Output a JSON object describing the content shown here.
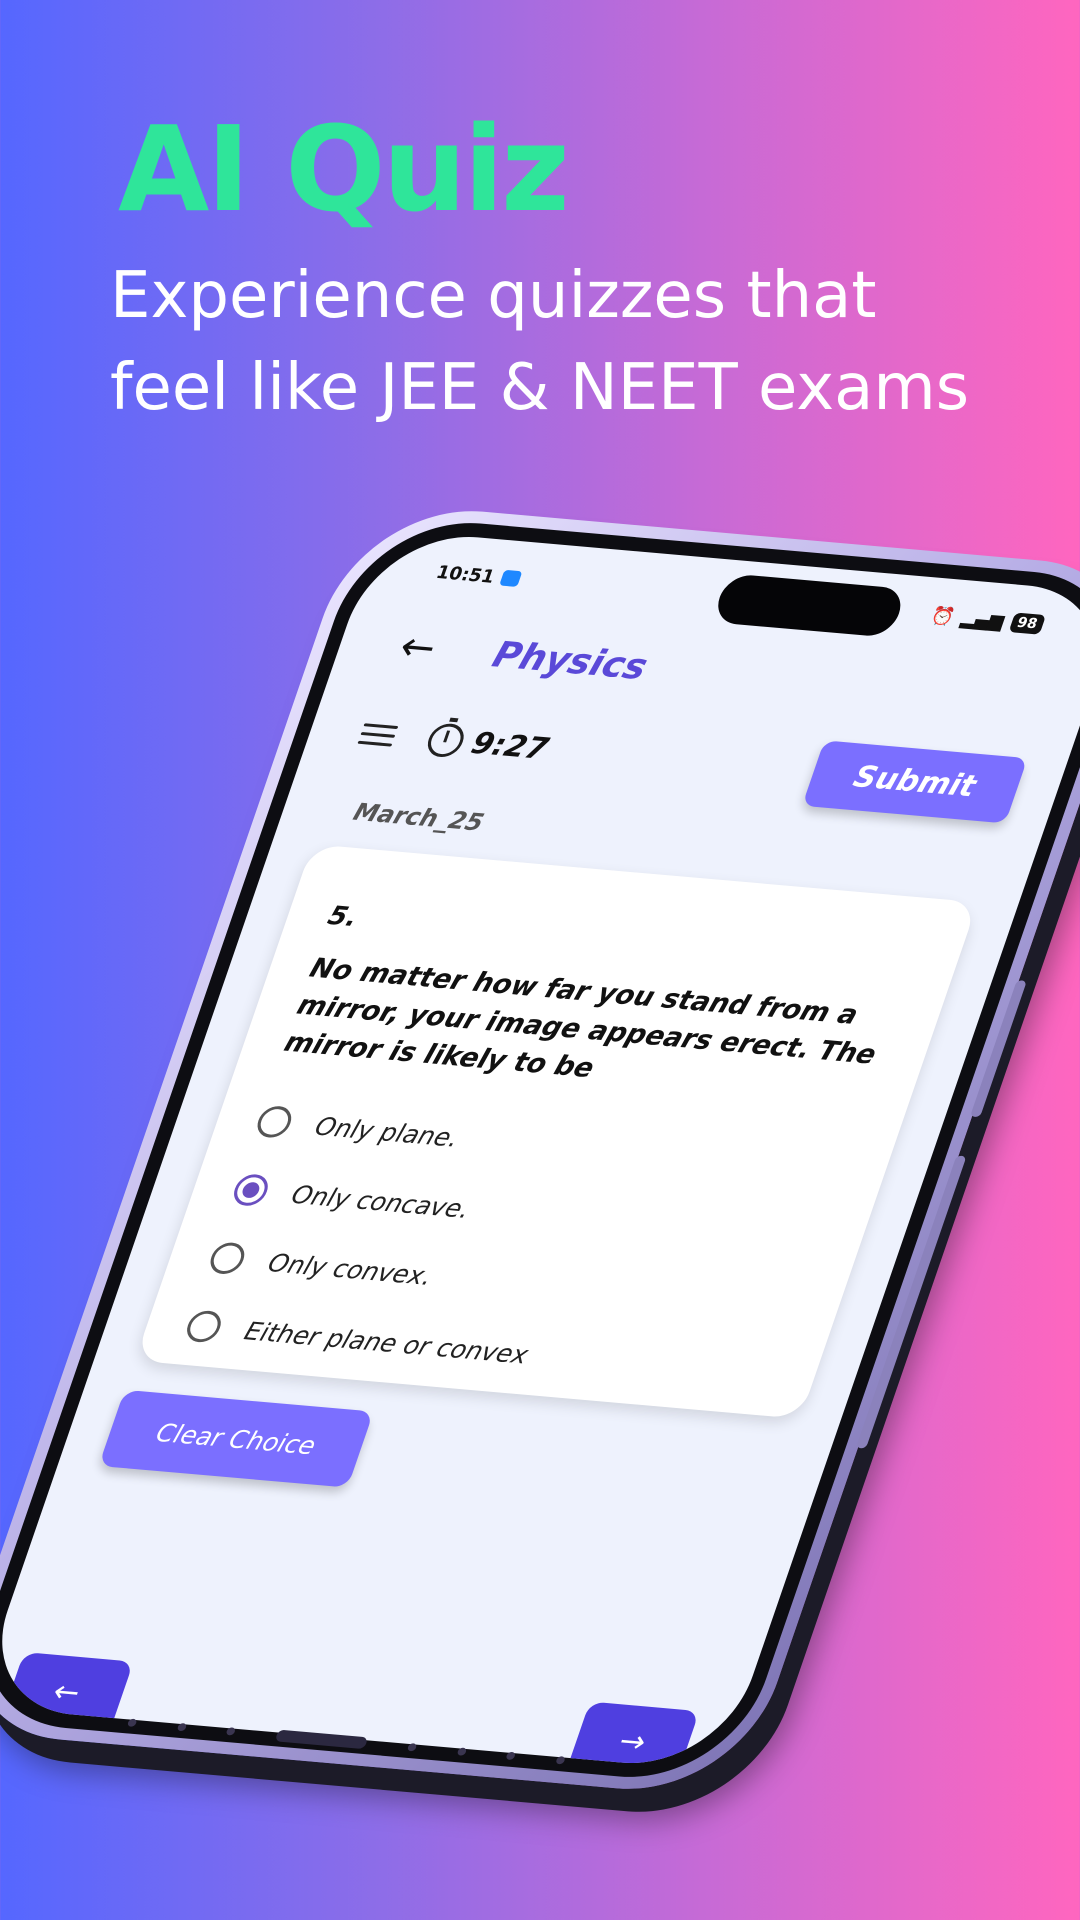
{
  "headline": {
    "title": "AI Quiz",
    "subtitle_line1": "Experience quizzes that",
    "subtitle_line2": "feel like JEE & NEET exams"
  },
  "colors": {
    "title": "#2fe59a",
    "accent": "#7b6fff",
    "nav": "#4f3fe0",
    "subject": "#5a49d8"
  },
  "status_bar": {
    "time": "10:51",
    "battery": "98",
    "icons": [
      "alarm-icon",
      "signal-icon"
    ]
  },
  "app_bar": {
    "back_icon": "back-arrow-icon",
    "title": "Physics"
  },
  "toolbar": {
    "menu_icon": "menu-icon",
    "timer_icon": "stopwatch-icon",
    "timer": "9:27",
    "submit_label": "Submit"
  },
  "quiz": {
    "set_label": "March_25",
    "question_number": "5.",
    "question_text": "No matter how far you stand from a mirror, your image appears erect. The mirror is likely to be",
    "options": [
      {
        "label": "Only plane.",
        "selected": false
      },
      {
        "label": "Only concave.",
        "selected": true
      },
      {
        "label": "Only convex.",
        "selected": false
      },
      {
        "label": "Either plane or convex",
        "selected": false
      }
    ],
    "clear_label": "Clear Choice"
  },
  "navigation": {
    "prev_icon": "arrow-left-icon",
    "next_icon": "arrow-right-icon"
  }
}
